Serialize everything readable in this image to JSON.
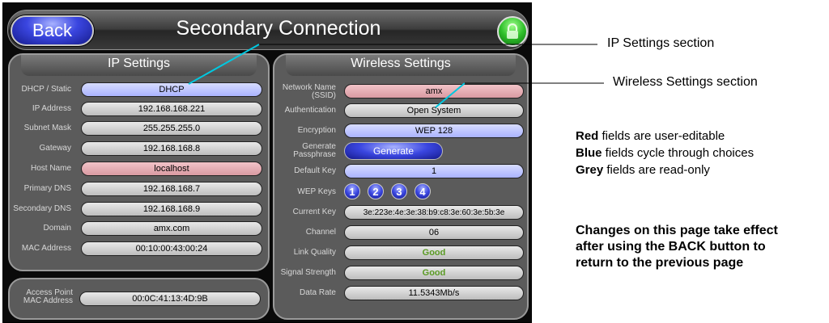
{
  "device": {
    "back_label": "Back",
    "title": "Secondary Connection"
  },
  "ip_settings": {
    "title": "IP Settings",
    "rows": [
      {
        "label": "DHCP / Static",
        "value": "DHCP",
        "kind": "blue"
      },
      {
        "label": "IP Address",
        "value": "192.168.168.221",
        "kind": "grey"
      },
      {
        "label": "Subnet Mask",
        "value": "255.255.255.0",
        "kind": "grey"
      },
      {
        "label": "Gateway",
        "value": "192.168.168.8",
        "kind": "grey"
      },
      {
        "label": "Host Name",
        "value": "localhost",
        "kind": "red"
      },
      {
        "label": "Primary DNS",
        "value": "192.168.168.7",
        "kind": "grey"
      },
      {
        "label": "Secondary DNS",
        "value": "192.168.168.9",
        "kind": "grey"
      },
      {
        "label": "Domain",
        "value": "amx.com",
        "kind": "grey"
      },
      {
        "label": "MAC Address",
        "value": "00:10:00:43:00:24",
        "kind": "grey"
      }
    ]
  },
  "access_point": {
    "label": "Access Point MAC Address",
    "value": "00:0C:41:13:4D:9B"
  },
  "wireless_settings": {
    "title": "Wireless Settings",
    "network_name_label": "Network Name (SSID)",
    "network_name": "amx",
    "authentication_label": "Authentication",
    "authentication": "Open System",
    "encryption_label": "Encryption",
    "encryption": "WEP 128",
    "generate_label": "Generate Passphrase",
    "generate_button": "Generate",
    "default_key_label": "Default Key",
    "default_key": "1",
    "wep_keys_label": "WEP Keys",
    "wep_keys": [
      "1",
      "2",
      "3",
      "4"
    ],
    "current_key_label": "Current Key",
    "current_key": "3e:223e:4e:3e:38:b9:c8:3e:60:3e:5b:3e",
    "channel_label": "Channel",
    "channel": "06",
    "link_quality_label": "Link Quality",
    "link_quality": "Good",
    "signal_strength_label": "Signal Strength",
    "signal_strength": "Good",
    "data_rate_label": "Data Rate",
    "data_rate": "11.5343Mb/s"
  },
  "annotations": {
    "ip_section": "IP Settings section",
    "wireless_section": "Wireless Settings section",
    "legend": [
      {
        "bold": "Red",
        "text": " fields are user-editable"
      },
      {
        "bold": "Blue",
        "text": " fields cycle through choices"
      },
      {
        "bold": "Grey",
        "text": " fields are read-only"
      }
    ],
    "changes_note": "Changes on this page take effect after using the BACK button to return to the previous page"
  },
  "colors": {
    "editable": "#d99aa2",
    "cycle": "#aab3ff",
    "readonly": "#bdbdbd",
    "pointer_line": "#00c8e0",
    "good": "#5a9b23"
  }
}
